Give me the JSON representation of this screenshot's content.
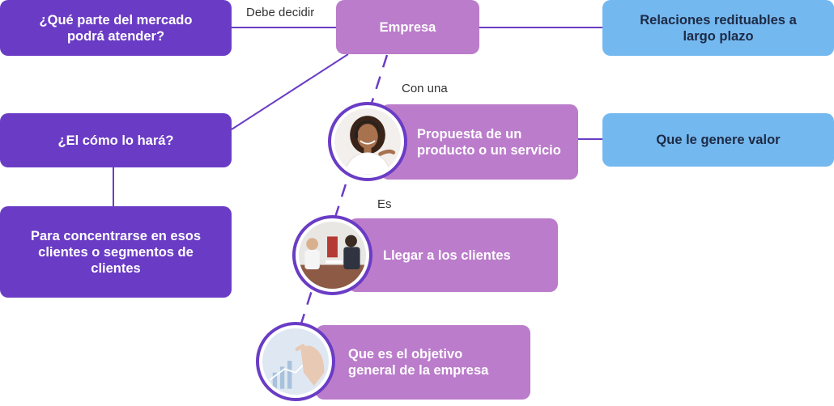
{
  "nodes": {
    "mercado": "¿Qué parte del mercado podrá atender?",
    "empresa": "Empresa",
    "relaciones": "Relaciones redituables a largo plazo",
    "como": "¿El cómo lo hará?",
    "propuesta": "Propuesta de un producto o un servicio",
    "valor": "Que le genere valor",
    "concentrarse": "Para concentrarse en esos clientes o segmentos de clientes",
    "llegar": "Llegar a los clientes",
    "objetivo": "Que es el objetivo general de la empresa"
  },
  "labels": {
    "debe_decidir": "Debe decidir",
    "con_una": "Con una",
    "es": "Es"
  },
  "images": {
    "photo_1": "woman-with-headset-photo",
    "photo_2": "business-meeting-photo",
    "photo_3": "hand-touching-chart-photo"
  },
  "colors": {
    "dark_purple": "#6a3cc5",
    "light_purple": "#bb7ccb",
    "light_blue": "#74b8f0"
  }
}
